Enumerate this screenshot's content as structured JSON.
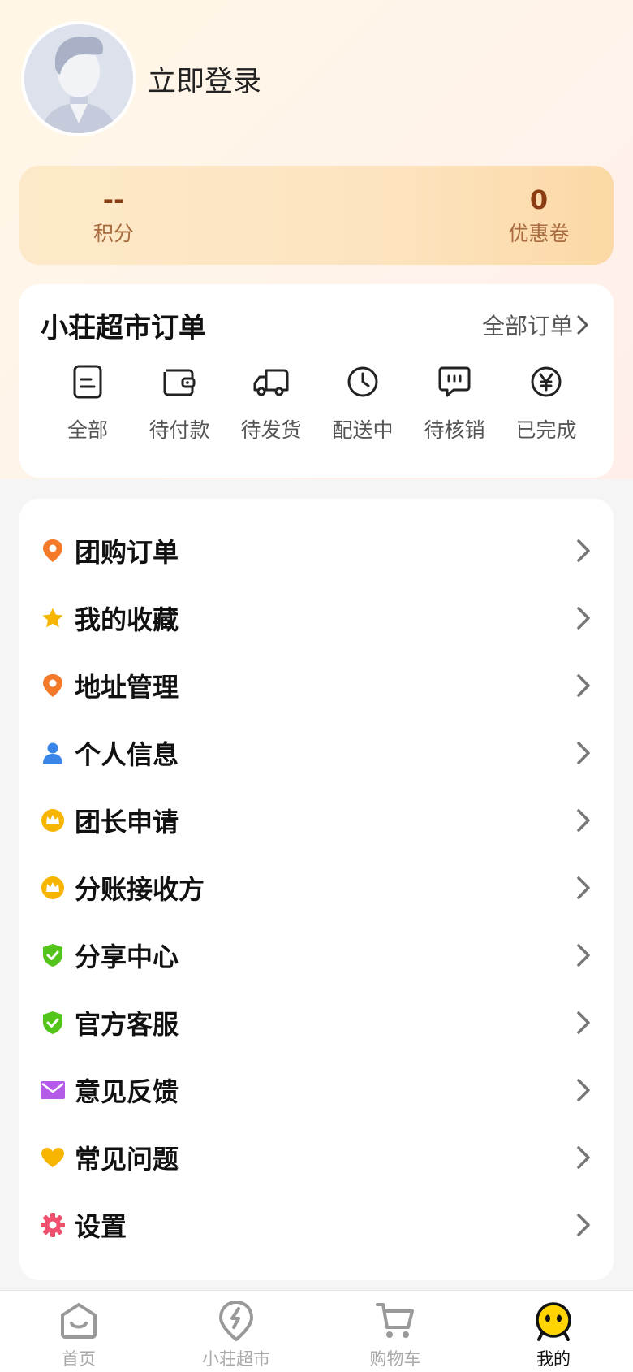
{
  "profile": {
    "login_text": "立即登录"
  },
  "stats": {
    "points": {
      "value": "--",
      "label": "积分"
    },
    "coupons": {
      "value": "0",
      "label": "优惠卷"
    }
  },
  "orders": {
    "title": "小荘超市订单",
    "all_label": "全部订单",
    "items": [
      {
        "label": "全部",
        "icon": "document-icon"
      },
      {
        "label": "待付款",
        "icon": "wallet-icon"
      },
      {
        "label": "待发货",
        "icon": "truck-icon"
      },
      {
        "label": "配送中",
        "icon": "clock-icon"
      },
      {
        "label": "待核销",
        "icon": "chat-icon"
      },
      {
        "label": "已完成",
        "icon": "yen-icon"
      }
    ]
  },
  "menu": {
    "items": [
      {
        "label": "团购订单",
        "icon": "location-pin-icon",
        "color": "#f47a2a"
      },
      {
        "label": "我的收藏",
        "icon": "star-icon",
        "color": "#f7b500"
      },
      {
        "label": "地址管理",
        "icon": "location-pin-icon",
        "color": "#f47a2a"
      },
      {
        "label": "个人信息",
        "icon": "person-icon",
        "color": "#3a86e8"
      },
      {
        "label": "团长申请",
        "icon": "crown-icon",
        "color": "#f7b500"
      },
      {
        "label": "分账接收方",
        "icon": "crown-icon",
        "color": "#f7b500"
      },
      {
        "label": "分享中心",
        "icon": "shield-check-icon",
        "color": "#52c41a"
      },
      {
        "label": "官方客服",
        "icon": "shield-check-icon",
        "color": "#52c41a"
      },
      {
        "label": "意见反馈",
        "icon": "mail-icon",
        "color": "#b45ce8"
      },
      {
        "label": "常见问题",
        "icon": "heart-icon",
        "color": "#f7b500"
      },
      {
        "label": "设置",
        "icon": "gear-icon",
        "color": "#f0506e"
      }
    ]
  },
  "tabbar": {
    "items": [
      {
        "label": "首页",
        "icon": "home-face-icon",
        "active": false
      },
      {
        "label": "小荘超市",
        "icon": "lightning-icon",
        "active": false
      },
      {
        "label": "购物车",
        "icon": "cart-icon",
        "active": false
      },
      {
        "label": "我的",
        "icon": "smiley-icon",
        "active": true
      }
    ]
  }
}
